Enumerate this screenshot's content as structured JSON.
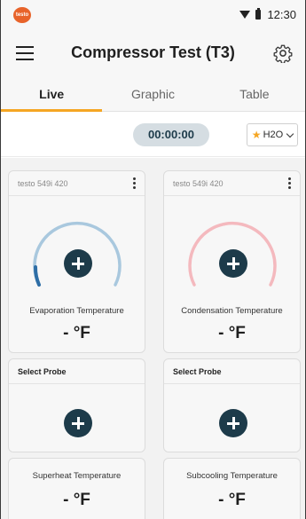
{
  "status": {
    "time": "12:30",
    "logo_text": "testo"
  },
  "header": {
    "title": "Compressor Test (T3)"
  },
  "tabs": [
    {
      "label": "Live",
      "active": true
    },
    {
      "label": "Graphic",
      "active": false
    },
    {
      "label": "Table",
      "active": false
    }
  ],
  "timer": {
    "value": "00:00:00"
  },
  "medium": {
    "label": "H2O",
    "favorite": true
  },
  "colors": {
    "accent": "#f5a623",
    "button": "#1d3b4a",
    "evap_arc": "#a9c8de",
    "evap_fill": "#2e6ea6",
    "cond_arc": "#f4b9be"
  },
  "cards": {
    "evap": {
      "header": "testo 549i  420",
      "label": "Evaporation Temperature",
      "value": "- °F"
    },
    "cond": {
      "header": "testo 549i  420",
      "label": "Condensation Temperature",
      "value": "- °F"
    },
    "probe_left": {
      "header": "Select Probe"
    },
    "probe_right": {
      "header": "Select Probe"
    },
    "superheat": {
      "label": "Superheat Temperature",
      "value": "- °F"
    },
    "subcool": {
      "label": "Subcooling Temperature",
      "value": "- °F"
    }
  }
}
